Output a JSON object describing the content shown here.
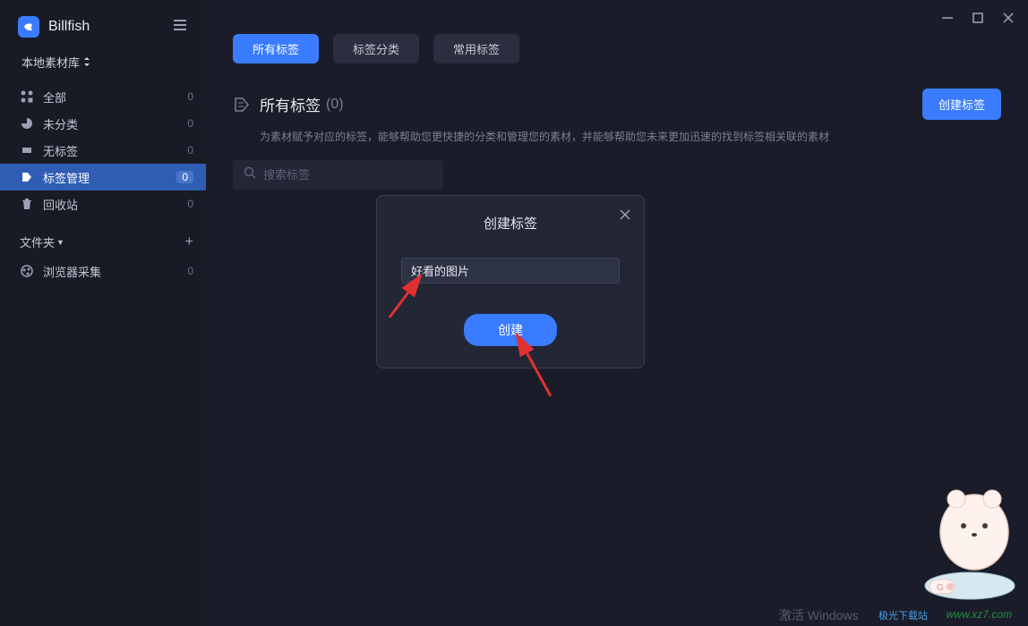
{
  "app": {
    "name": "Billfish"
  },
  "library": {
    "label": "本地素材库"
  },
  "sidebar": {
    "items": [
      {
        "label": "全部",
        "count": "0",
        "icon": "grid"
      },
      {
        "label": "未分类",
        "count": "0",
        "icon": "pie"
      },
      {
        "label": "无标签",
        "count": "0",
        "icon": "tag-off"
      },
      {
        "label": "标签管理",
        "count": "0",
        "icon": "tag"
      },
      {
        "label": "回收站",
        "count": "0",
        "icon": "trash"
      }
    ],
    "folder_header": "文件夹",
    "browser_collect": {
      "label": "浏览器采集",
      "count": "0"
    }
  },
  "tabs": [
    {
      "label": "所有标签",
      "active": true
    },
    {
      "label": "标签分类",
      "active": false
    },
    {
      "label": "常用标签",
      "active": false
    }
  ],
  "page": {
    "title": "所有标签",
    "count": "(0)",
    "desc": "为素材赋予对应的标签，能够帮助您更快捷的分类和管理您的素材，并能够帮助您未来更加迅速的找到标签相关联的素材",
    "create_button": "创建标签"
  },
  "search": {
    "placeholder": "搜索标签"
  },
  "modal": {
    "title": "创建标签",
    "input_value": "好看的图片",
    "submit": "创建"
  },
  "footer": {
    "activate": "激活 Windows",
    "watermark_site": "www.xz7.com",
    "watermark_name": "极光下载站"
  }
}
